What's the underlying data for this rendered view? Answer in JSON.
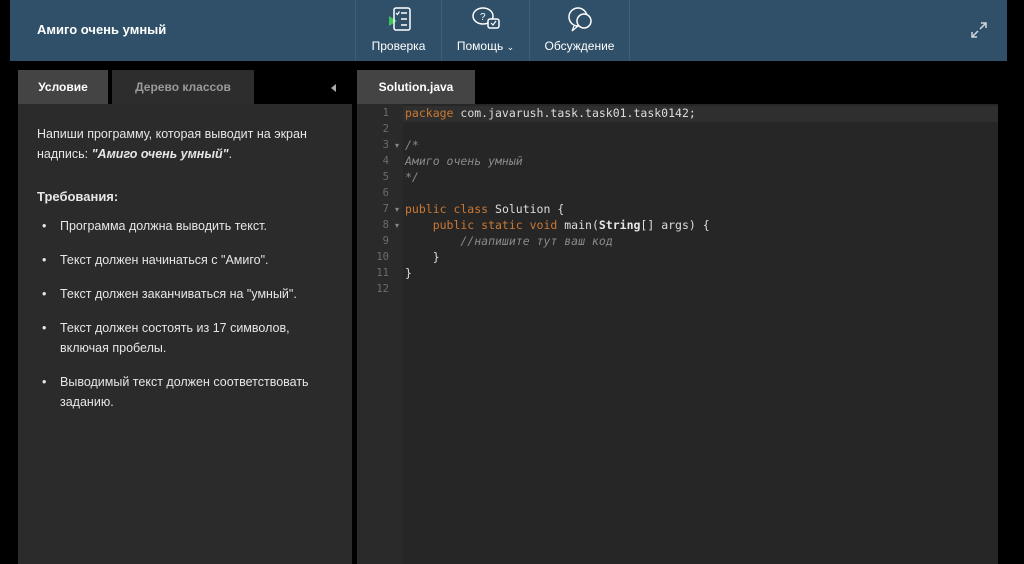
{
  "header": {
    "title": "Амиго очень умный",
    "tools": [
      {
        "label": "Проверка",
        "icon": "checklist-play-icon"
      },
      {
        "label": "Помощь",
        "icon": "help-chat-icon"
      },
      {
        "label": "Обсуждение",
        "icon": "discussion-icon"
      }
    ]
  },
  "left": {
    "tabs": [
      "Условие",
      "Дерево классов"
    ],
    "task_prefix": "Напиши программу, которая выводит на экран надпись: ",
    "task_quote": "\"Амиго очень умный\"",
    "task_suffix": ".",
    "req_title": "Требования:",
    "requirements": [
      "Программа должна выводить текст.",
      "Текст должен начинаться с \"Амиго\".",
      "Текст должен заканчиваться на \"умный\".",
      "Текст должен состоять из 17 символов, включая пробелы.",
      "Выводимый текст должен соответствовать заданию."
    ]
  },
  "editor": {
    "tab": "Solution.java",
    "line_numbers": [
      "1",
      "2",
      "3",
      "4",
      "5",
      "6",
      "7",
      "8",
      "9",
      "10",
      "11",
      "12"
    ],
    "code": {
      "l1_kw": "package",
      "l1_rest": " com.javarush.task.task01.task0142;",
      "l3": "/*",
      "l4": "Амиго очень умный",
      "l5": "*/",
      "l7_kw": "public class",
      "l7_rest": " Solution {",
      "l8_kw": "    public static void",
      "l8_rest": " main(",
      "l8_type": "String",
      "l8_end": "[] args) {",
      "l9": "        //напишите тут ваш код",
      "l10": "    }",
      "l11": "}"
    }
  }
}
